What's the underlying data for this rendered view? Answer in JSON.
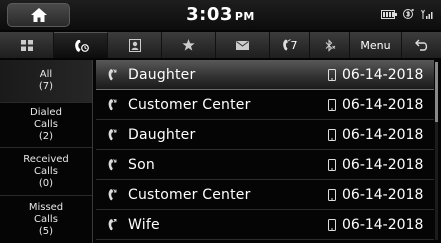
{
  "status": {
    "time": "3:03",
    "ampm": "PM"
  },
  "tabs": [
    {
      "name": "menu-grid",
      "icon": "grid-icon"
    },
    {
      "name": "call-history",
      "icon": "call-history-icon",
      "active": true
    },
    {
      "name": "contacts",
      "icon": "contacts-icon"
    },
    {
      "name": "favorites",
      "icon": "star-icon"
    },
    {
      "name": "messages",
      "icon": "envelope-icon"
    },
    {
      "name": "dial",
      "icon": "phone-icon",
      "label": "7"
    },
    {
      "name": "bluetooth",
      "icon": "bluetooth-icon"
    },
    {
      "name": "menu",
      "label": "Menu"
    },
    {
      "name": "back",
      "icon": "back-arrow-icon"
    }
  ],
  "categories": [
    {
      "name": "All",
      "count": "(7)",
      "active": true
    },
    {
      "name": "Dialed\nCalls",
      "count": "(2)"
    },
    {
      "name": "Received\nCalls",
      "count": "(0)"
    },
    {
      "name": "Missed\nCalls",
      "count": "(5)"
    }
  ],
  "calls": [
    {
      "type": "missed-call-icon",
      "name": "Daughter",
      "device": "phone-icon",
      "date": "06-14-2018",
      "selected": true
    },
    {
      "type": "missed-call-icon",
      "name": "Customer Center",
      "device": "phone-icon",
      "date": "06-14-2018"
    },
    {
      "type": "missed-call-icon",
      "name": "Daughter",
      "device": "phone-icon",
      "date": "06-14-2018"
    },
    {
      "type": "missed-call-icon",
      "name": "Son",
      "device": "phone-icon",
      "date": "06-14-2018"
    },
    {
      "type": "missed-call-icon",
      "name": "Customer Center",
      "device": "phone-icon",
      "date": "06-14-2018"
    },
    {
      "type": "dialed-call-icon",
      "name": "Wife",
      "device": "phone-icon",
      "date": "06-14-2018"
    }
  ]
}
